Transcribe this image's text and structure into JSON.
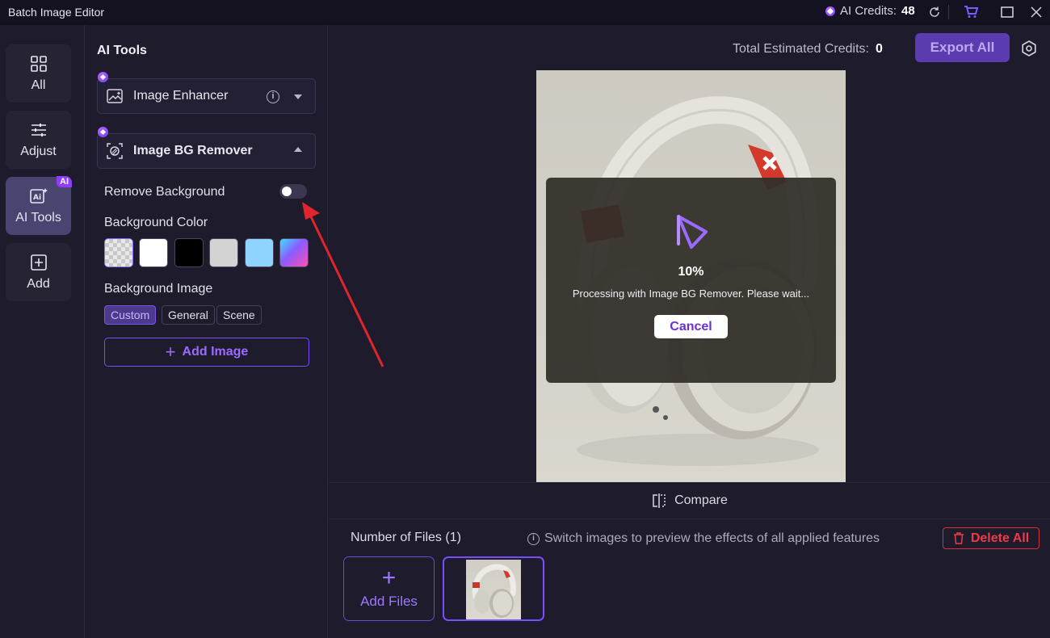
{
  "titlebar": {
    "title": "Batch Image Editor",
    "credits_label": "AI Credits:",
    "credits_value": "48"
  },
  "rail": {
    "items": [
      {
        "label": "All",
        "icon": "grid-icon"
      },
      {
        "label": "Adjust",
        "icon": "sliders-icon"
      },
      {
        "label": "AI Tools",
        "icon": "ai-icon",
        "badge": "AI"
      },
      {
        "label": "Add",
        "icon": "plus-square-icon"
      }
    ]
  },
  "panel": {
    "heading": "AI Tools",
    "enhancer_label": "Image Enhancer",
    "bg_remover_label": "Image BG Remover",
    "remove_bg_label": "Remove Background",
    "remove_bg_enabled": false,
    "bg_color_label": "Background Color",
    "swatches": [
      "transparent",
      "#ffffff",
      "#000000",
      "#d3d3d3",
      "#8fd3ff",
      "gradient"
    ],
    "bg_image_label": "Background Image",
    "bg_image_tabs": [
      "Custom",
      "General",
      "Scene"
    ],
    "bg_image_selected": "Custom",
    "add_image_label": "Add Image"
  },
  "main": {
    "est_label": "Total Estimated Credits:",
    "est_value": "0",
    "export_label": "Export All",
    "processing": {
      "percent": "10%",
      "message": "Processing with Image BG Remover. Please wait...",
      "cancel_label": "Cancel"
    },
    "compare_label": "Compare"
  },
  "files": {
    "count_label": "Number of Files (1)",
    "hint": "Switch images to preview the effects of all applied features",
    "delete_label": "Delete All",
    "add_files_label": "Add Files"
  },
  "colors": {
    "accent": "#7a4dff",
    "danger": "#e0343e",
    "bg": "#1e1b2c"
  }
}
